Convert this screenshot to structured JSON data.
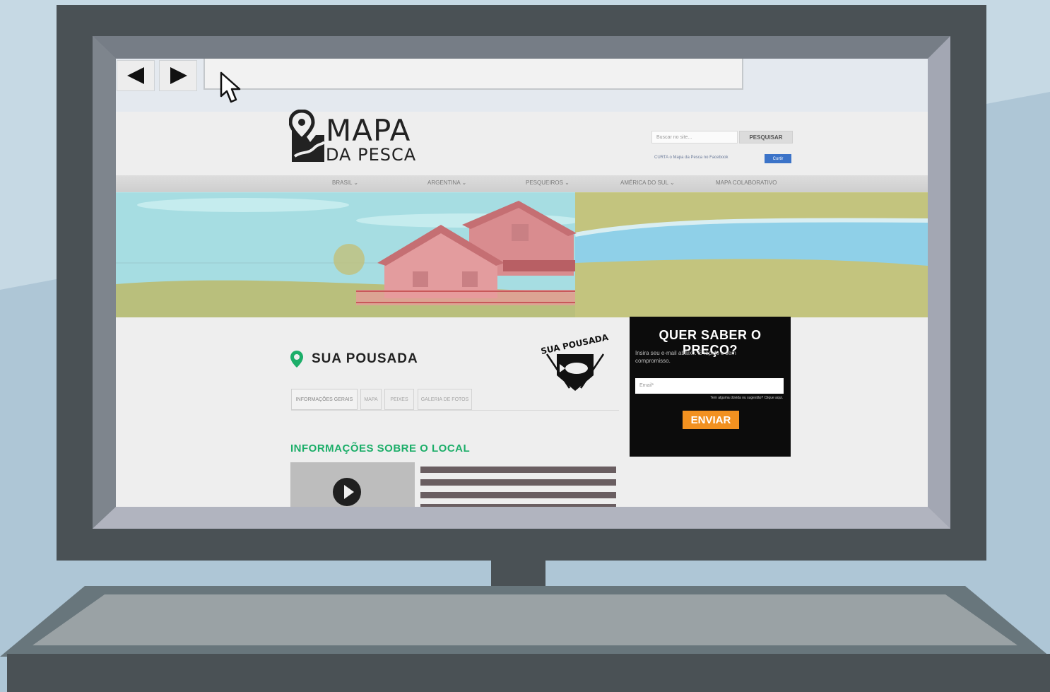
{
  "browser": {
    "back_icon": "back-arrow-icon",
    "forward_icon": "forward-arrow-icon",
    "address_value": "",
    "cursor_icon": "mouse-pointer-icon"
  },
  "site": {
    "logo_mapa": "MAPA",
    "logo_da_pesca": "DA PESCA",
    "search_placeholder": "Buscar no site...",
    "search_button": "PESQUISAR",
    "facebook_text": "CURTA o Mapa da Pesca no Facebook",
    "facebook_button": "Curtir",
    "menu": [
      {
        "label": "BRASIL",
        "icon": "chevron-down-icon"
      },
      {
        "label": "ARGENTINA",
        "icon": "chevron-down-icon"
      },
      {
        "label": "PESQUEIROS",
        "icon": "chevron-down-icon"
      },
      {
        "label": "AMÉRICA DO SUL",
        "icon": "chevron-down-icon"
      },
      {
        "label": "MAPA COLABORATIVO",
        "icon": ""
      }
    ]
  },
  "content": {
    "title": "SUA POUSADA",
    "badge_text": "SUA POUSADA",
    "tabs": [
      "INFORMAÇÕES GERAIS",
      "MAPA",
      "PEIXES",
      "GALERIA DE FOTOS"
    ],
    "section_title": "INFORMAÇÕES SOBRE O LOCAL"
  },
  "cta": {
    "title": "QUER SABER O PREÇO?",
    "description": "Insira seu e-mail abaixo. É rápido e sem compromisso.",
    "email_placeholder": "Email*",
    "help_text": "Tem alguma dúvida ou sugestão? Clique aqui.",
    "submit": "ENVIAR"
  },
  "colors": {
    "accent_green": "#1cae69",
    "cta_orange": "#f29120",
    "monitor_frame": "#4a5155",
    "facebook_blue": "#3b73c8"
  }
}
